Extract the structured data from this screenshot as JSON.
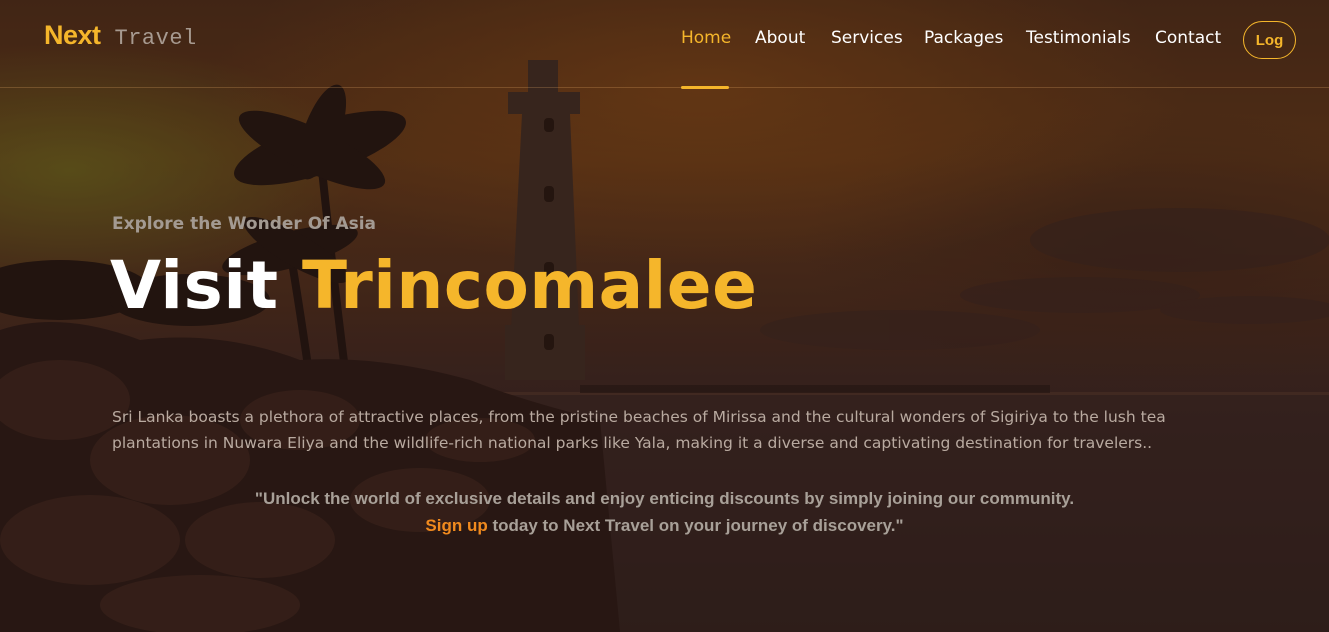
{
  "brand": {
    "name_primary": "Next",
    "name_secondary": "Travel"
  },
  "nav": {
    "items": [
      {
        "label": "Home",
        "active": true
      },
      {
        "label": "About",
        "active": false
      },
      {
        "label": "Services",
        "active": false
      },
      {
        "label": "Packages",
        "active": false
      },
      {
        "label": "Testimonials",
        "active": false
      },
      {
        "label": "Contact",
        "active": false
      }
    ],
    "login_label": "Log"
  },
  "hero": {
    "eyebrow": "Explore the Wonder Of Asia",
    "title_prefix": "Visit",
    "title_accent": "Trincomalee",
    "description": "Sri Lanka boasts a plethora of attractive places, from the pristine beaches of Mirissa and the cultural wonders of Sigiriya to the lush tea plantations in Nuwara Eliya and the wildlife-rich national parks like Yala, making it a diverse and captivating destination for travelers..",
    "cta_line1": "\"Unlock the world of exclusive details and enjoy enticing discounts by simply joining our community.",
    "cta_link": "Sign up",
    "cta_line2": " today to Next Travel on your journey of discovery.\""
  },
  "colors": {
    "accent": "#f5b62b",
    "signup": "#f08a1e",
    "text_muted": "#a39a92"
  }
}
